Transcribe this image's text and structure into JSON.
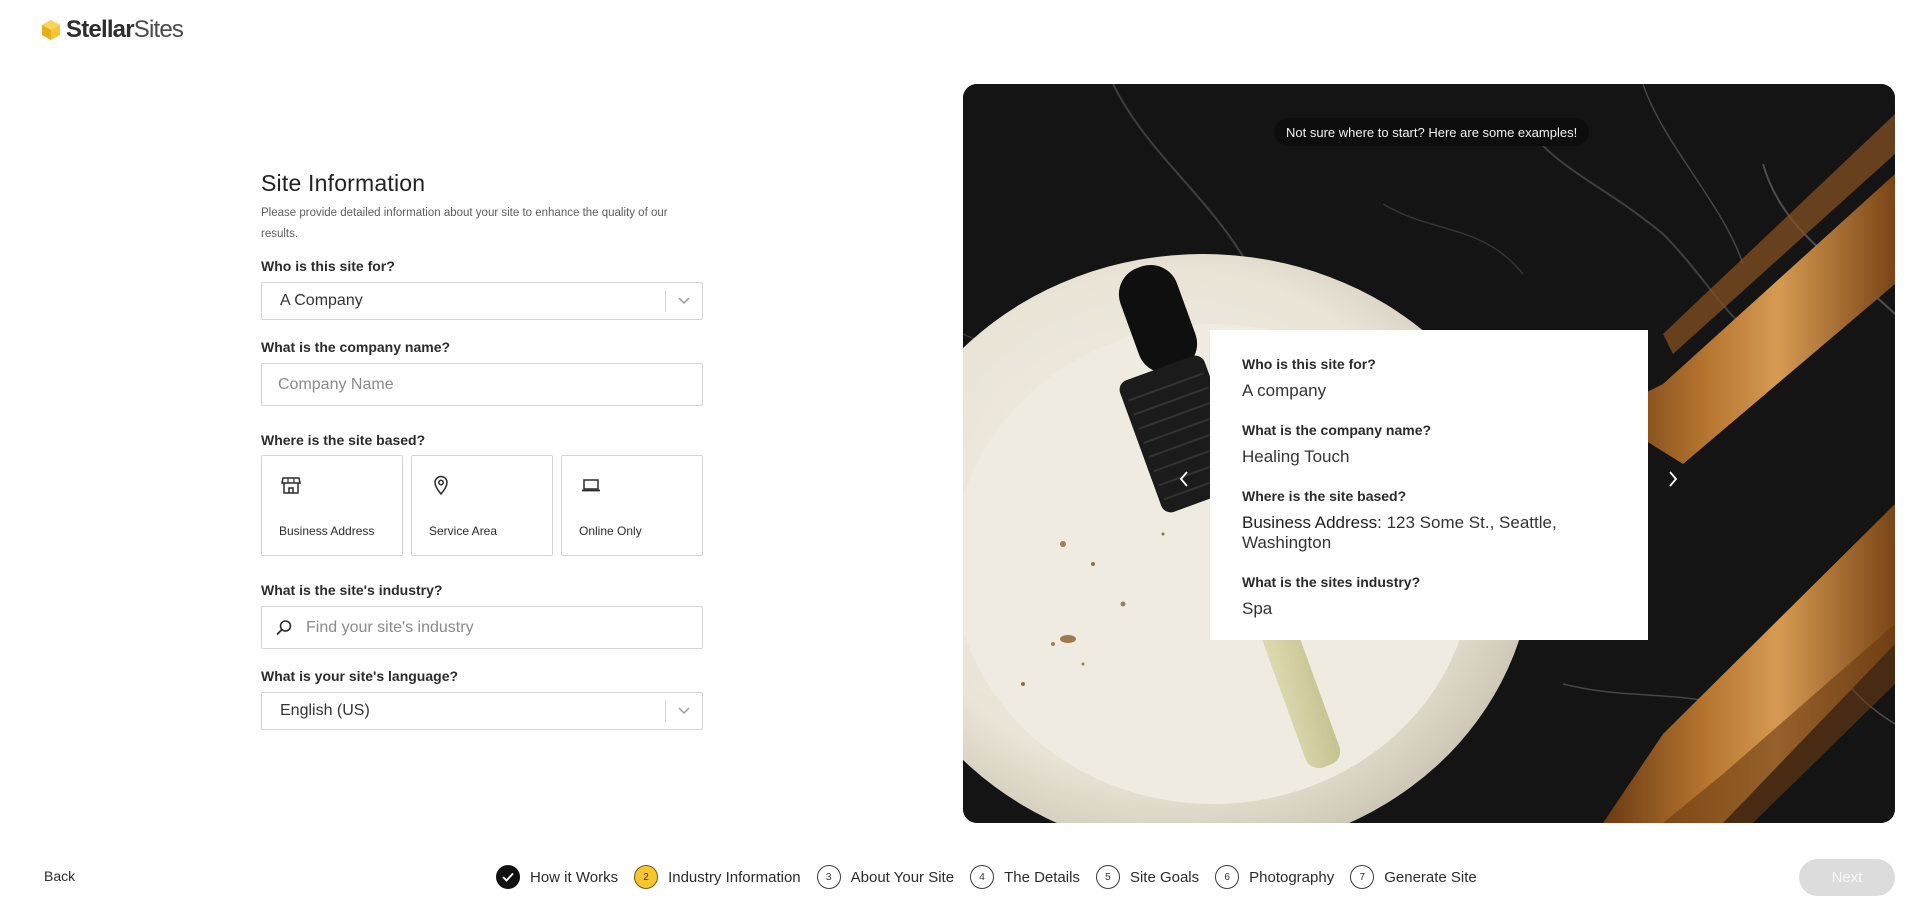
{
  "brand": {
    "name_bold": "Stellar",
    "name_light": "Sites",
    "accent": "#f7c531"
  },
  "form": {
    "title": "Site Information",
    "description": "Please provide detailed information about your site to enhance the quality of our results.",
    "who_label": "Who is this site for?",
    "who_value": "A Company",
    "company_label": "What is the company name?",
    "company_placeholder": "Company Name",
    "based_label": "Where is the site based?",
    "based_options": [
      {
        "label": "Business Address",
        "icon": "store-icon"
      },
      {
        "label": "Service Area",
        "icon": "map-pin-icon"
      },
      {
        "label": "Online Only",
        "icon": "laptop-icon"
      }
    ],
    "industry_label": "What is the site's industry?",
    "industry_placeholder": "Find your site's industry",
    "language_label": "What is your site's language?",
    "language_value": "English (US)"
  },
  "example": {
    "tip": "Not sure where to start? Here are some examples!",
    "items": [
      {
        "q": "Who is this site for?",
        "a": "A company"
      },
      {
        "q": "What is the company name?",
        "a": "Healing Touch"
      },
      {
        "q": "Where is the site based?",
        "a_prefix": "Business Address:",
        "a": " 123 Some St., Seattle, Washington"
      },
      {
        "q": "What is the sites industry?",
        "a": "Spa"
      }
    ]
  },
  "footer": {
    "back": "Back",
    "next": "Next",
    "steps": [
      {
        "num": "",
        "label": "How it Works",
        "state": "done"
      },
      {
        "num": "2",
        "label": "Industry Information",
        "state": "active"
      },
      {
        "num": "3",
        "label": "About Your Site",
        "state": "todo"
      },
      {
        "num": "4",
        "label": "The Details",
        "state": "todo"
      },
      {
        "num": "5",
        "label": "Site Goals",
        "state": "todo"
      },
      {
        "num": "6",
        "label": "Photography",
        "state": "todo"
      },
      {
        "num": "7",
        "label": "Generate Site",
        "state": "todo"
      }
    ]
  }
}
